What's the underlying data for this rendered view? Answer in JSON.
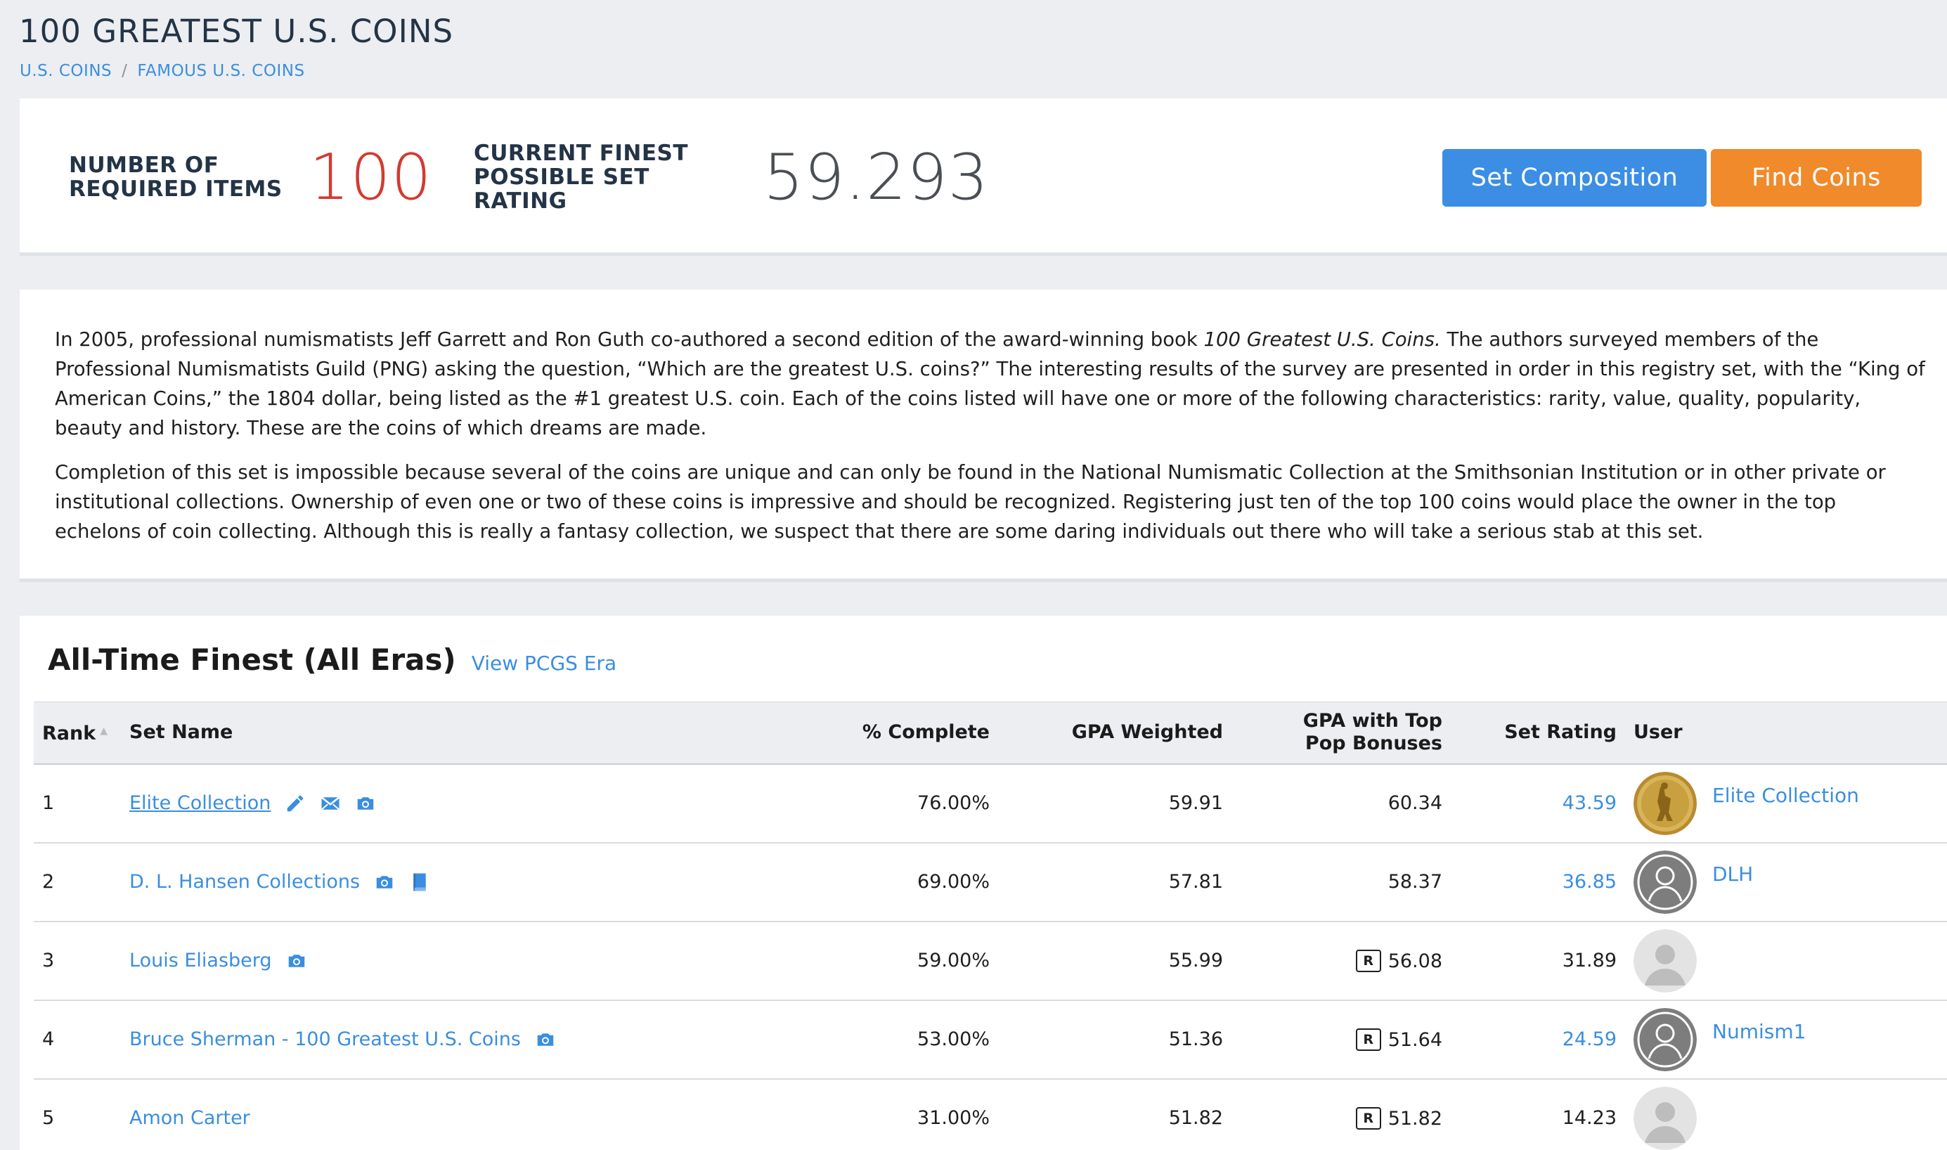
{
  "page": {
    "title": "100 GREATEST U.S. COINS",
    "breadcrumb": [
      {
        "label": "U.S. COINS"
      },
      {
        "label": "FAMOUS U.S. COINS"
      }
    ],
    "breadcrumb_separator": "/"
  },
  "summary": {
    "required_label": "NUMBER OF REQUIRED ITEMS",
    "required_value": "100",
    "finest_label": "CURRENT FINEST POSSIBLE SET RATING",
    "finest_value": "59.293",
    "set_composition_button": "Set Composition",
    "find_coins_button": "Find Coins",
    "colors": {
      "required_value": "#d33a30",
      "composition_button": "#3b8ee3",
      "find_button": "#f08a2b"
    }
  },
  "description": {
    "p1_before": "In 2005, professional numismatists Jeff Garrett and Ron Guth co-authored a second edition of the award-winning book ",
    "p1_book": "100 Greatest U.S. Coins.",
    "p1_after": " The authors surveyed members of the Professional Numismatists Guild (PNG) asking the question, “Which are the greatest U.S. coins?” The interesting results of the survey are presented in order in this registry set, with the “King of American Coins,” the 1804 dollar, being listed as the #1 greatest U.S. coin. Each of the coins listed will have one or more of the following characteristics: rarity, value, quality, popularity, beauty and history. These are the coins of which dreams are made.",
    "p2": "Completion of this set is impossible because several of the coins are unique and can only be found in the National Numismatic Collection at the Smithsonian Institution or in other private or institutional collections. Ownership of even one or two of these coins is impressive and should be recognized. Registering just ten of the top 100 coins would place the owner in the top echelons of coin collecting. Although this is really a fantasy collection, we suspect that there are some daring individuals out there who will take a serious stab at this set."
  },
  "finest": {
    "title": "All-Time Finest (All Eras)",
    "era_link": "View PCGS Era",
    "columns": {
      "rank": "Rank",
      "set_name": "Set Name",
      "complete": "% Complete",
      "gpa_weighted": "GPA Weighted",
      "gpa_top_line1": "GPA with Top",
      "gpa_top_line2": "Pop Bonuses",
      "set_rating": "Set Rating",
      "user": "User"
    },
    "rows": [
      {
        "rank": "1",
        "set_name": "Elite Collection",
        "complete": "76.00%",
        "gpa_weighted": "59.91",
        "gpa_top": "60.34",
        "set_rating": "43.59",
        "user": "Elite Collection",
        "icons": [
          "pencil-icon",
          "envelope-icon",
          "camera-icon"
        ],
        "badge": ""
      },
      {
        "rank": "2",
        "set_name": "D. L. Hansen Collections",
        "complete": "69.00%",
        "gpa_weighted": "57.81",
        "gpa_top": "58.37",
        "set_rating": "36.85",
        "user": "DLH",
        "icons": [
          "camera-icon",
          "book-icon"
        ],
        "badge": ""
      },
      {
        "rank": "3",
        "set_name": "Louis Eliasberg",
        "complete": "59.00%",
        "gpa_weighted": "55.99",
        "gpa_top": "56.08",
        "set_rating": "31.89",
        "user": "",
        "icons": [
          "camera-icon"
        ],
        "badge": "R"
      },
      {
        "rank": "4",
        "set_name": "Bruce Sherman - 100 Greatest U.S. Coins",
        "complete": "53.00%",
        "gpa_weighted": "51.36",
        "gpa_top": "51.64",
        "set_rating": "24.59",
        "user": "Numism1",
        "icons": [
          "camera-icon"
        ],
        "badge": "R"
      },
      {
        "rank": "5",
        "set_name": "Amon Carter",
        "complete": "31.00%",
        "gpa_weighted": "51.82",
        "gpa_top": "51.82",
        "set_rating": "14.23",
        "user": "",
        "icons": [],
        "badge": "R"
      }
    ]
  }
}
